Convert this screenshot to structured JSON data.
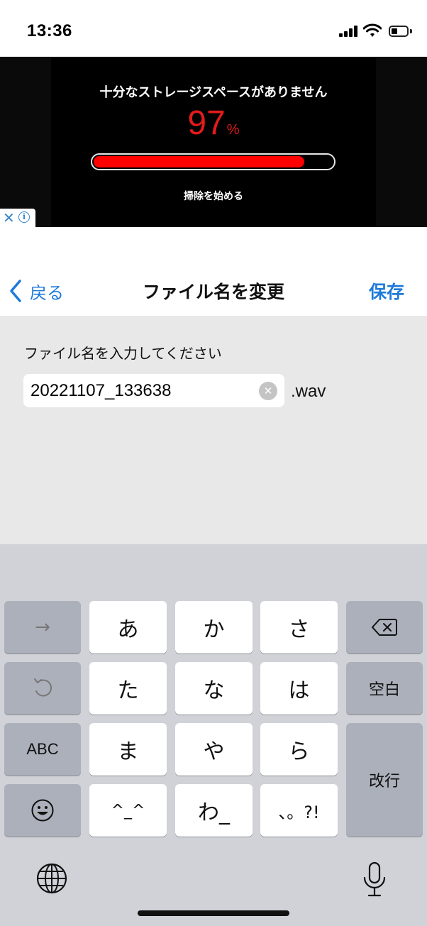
{
  "status_bar": {
    "time": "13:36"
  },
  "ad": {
    "title": "十分なストレージスペースがありません",
    "percent_value": "97",
    "percent_unit": "%",
    "progress": 0.88,
    "cta": "掃除を始める",
    "colors": {
      "accent": "#e21b1b",
      "bar": "#ff0000",
      "background": "#000000"
    }
  },
  "nav": {
    "back_label": "戻る",
    "title": "ファイル名を変更",
    "save_label": "保存",
    "accent": "#1f7ad9"
  },
  "form": {
    "label": "ファイル名を入力してください",
    "filename_value": "20221107_133638",
    "extension": ".wav"
  },
  "keyboard": {
    "keys": {
      "arrow": "→",
      "a": "あ",
      "ka": "か",
      "sa": "さ",
      "ta": "た",
      "na": "な",
      "ha": "は",
      "space": "空白",
      "abc": "ABC",
      "ma": "ま",
      "ya": "や",
      "ra": "ら",
      "return": "改行",
      "kaomoji": "^_^",
      "wa": "わ_",
      "punct": "、。?!"
    }
  }
}
